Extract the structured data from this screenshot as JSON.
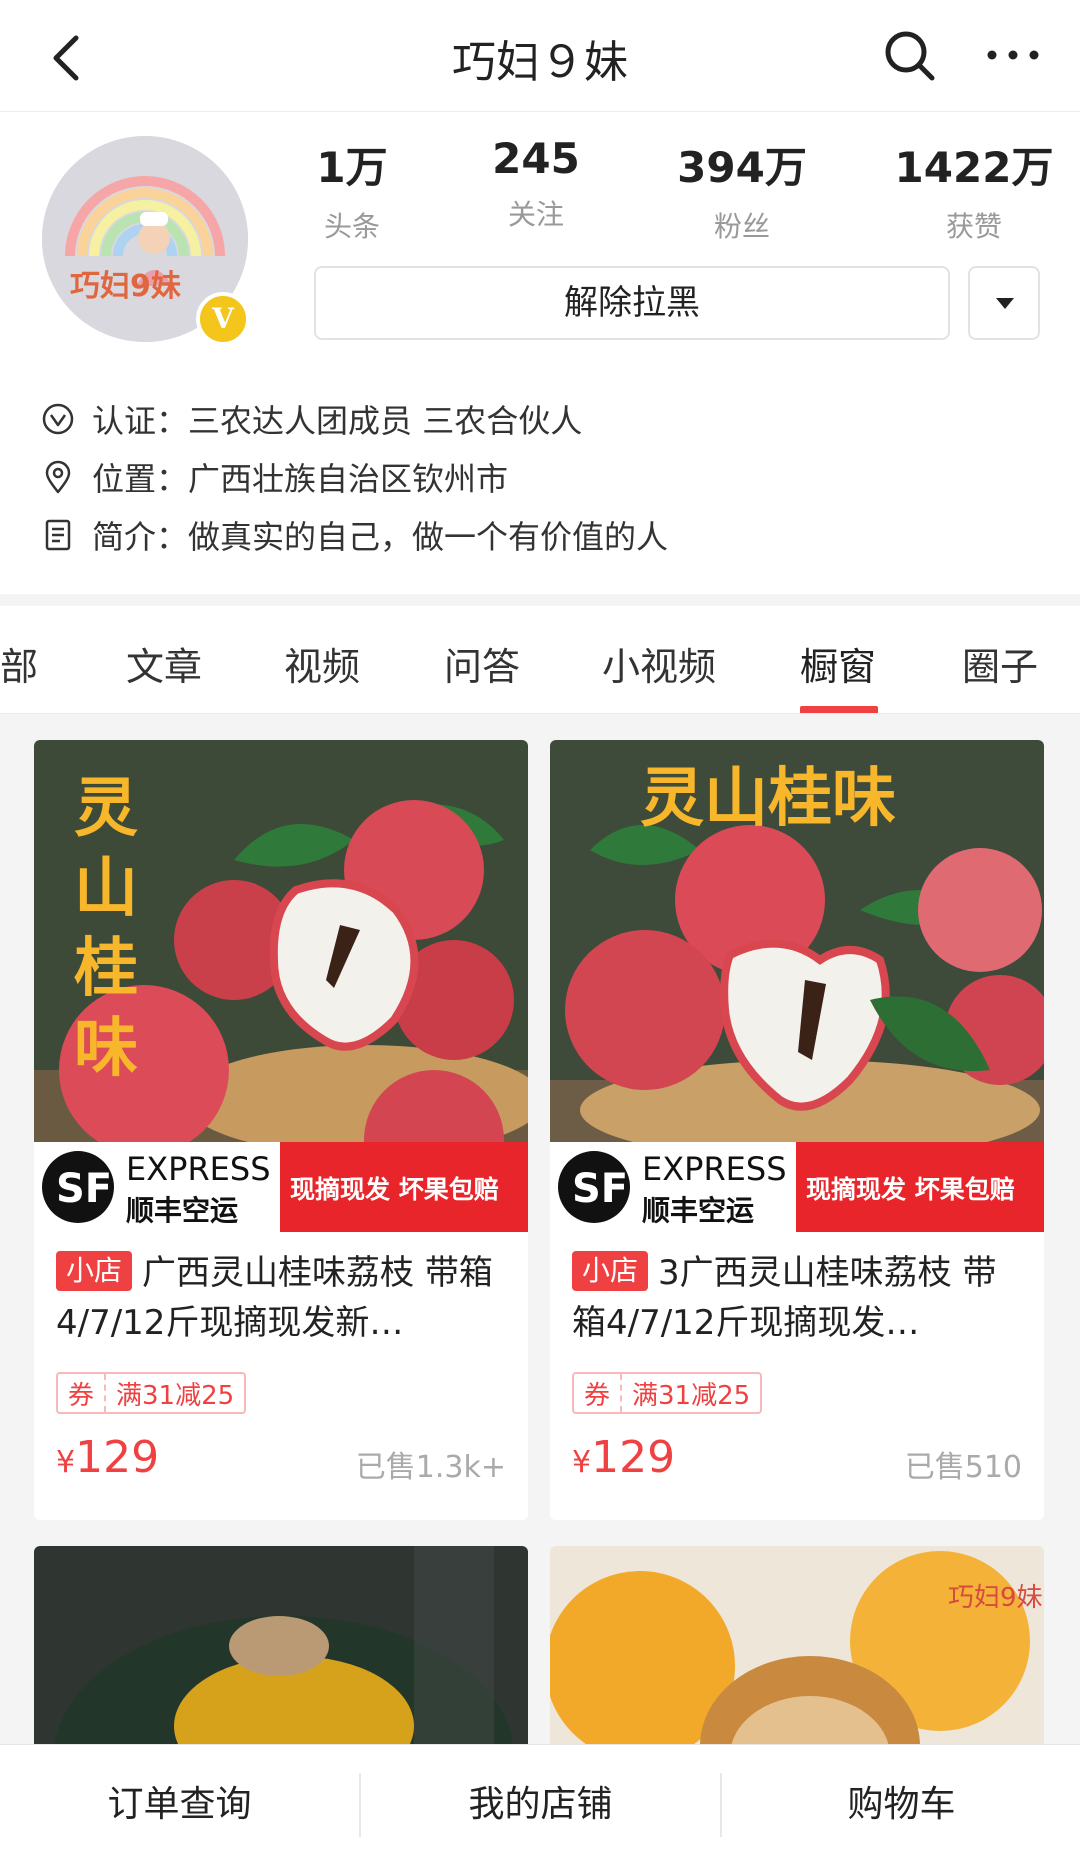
{
  "header": {
    "title": "巧妇９妹"
  },
  "profile": {
    "avatar_text": "巧妇9妹",
    "stats": [
      {
        "value": "1万",
        "label": "头条"
      },
      {
        "value": "245",
        "label": "关注"
      },
      {
        "value": "394万",
        "label": "粉丝"
      },
      {
        "value": "1422万",
        "label": "获赞"
      }
    ],
    "unblock_label": "解除拉黑",
    "verified_badge": "V",
    "info": [
      {
        "icon": "verified-icon",
        "key": "认证：",
        "value": "三农达人团成员 三农合伙人"
      },
      {
        "icon": "location-icon",
        "key": "位置：",
        "value": "广西壮族自治区钦州市"
      },
      {
        "icon": "document-icon",
        "key": "简介：",
        "value": "做真实的自己，做一个有价值的人"
      }
    ]
  },
  "tabs": [
    "全部",
    "文章",
    "视频",
    "问答",
    "小视频",
    "橱窗",
    "圈子"
  ],
  "active_tab": "橱窗",
  "products": [
    {
      "image_text": "灵山桂味",
      "badge_express": "EXPRESS",
      "badge_sf": "顺丰空运",
      "badge_red": "现摘现发  坏果包赔",
      "shop_tag": "小店",
      "title": "广西灵山桂味荔枝 带箱4/7/12斤现摘现发新…",
      "coupon_label": "券",
      "coupon_text": "满31减25",
      "currency": "¥",
      "price": "129",
      "sold": "已售1.3k+"
    },
    {
      "image_text": "灵山桂味",
      "badge_express": "EXPRESS",
      "badge_sf": "顺丰空运",
      "badge_red": "现摘现发  坏果包赔",
      "shop_tag": "小店",
      "title": "3广西灵山桂味荔枝 带箱4/7/12斤现摘现发…",
      "coupon_label": "券",
      "coupon_text": "满31减25",
      "currency": "¥",
      "price": "129",
      "sold": "已售510"
    }
  ],
  "watermark_text": "巧妇9妹",
  "bottom_nav": [
    "订单查询",
    "我的店铺",
    "购物车"
  ],
  "colors": {
    "accent": "#f04142",
    "badge": "#f4c51b"
  }
}
